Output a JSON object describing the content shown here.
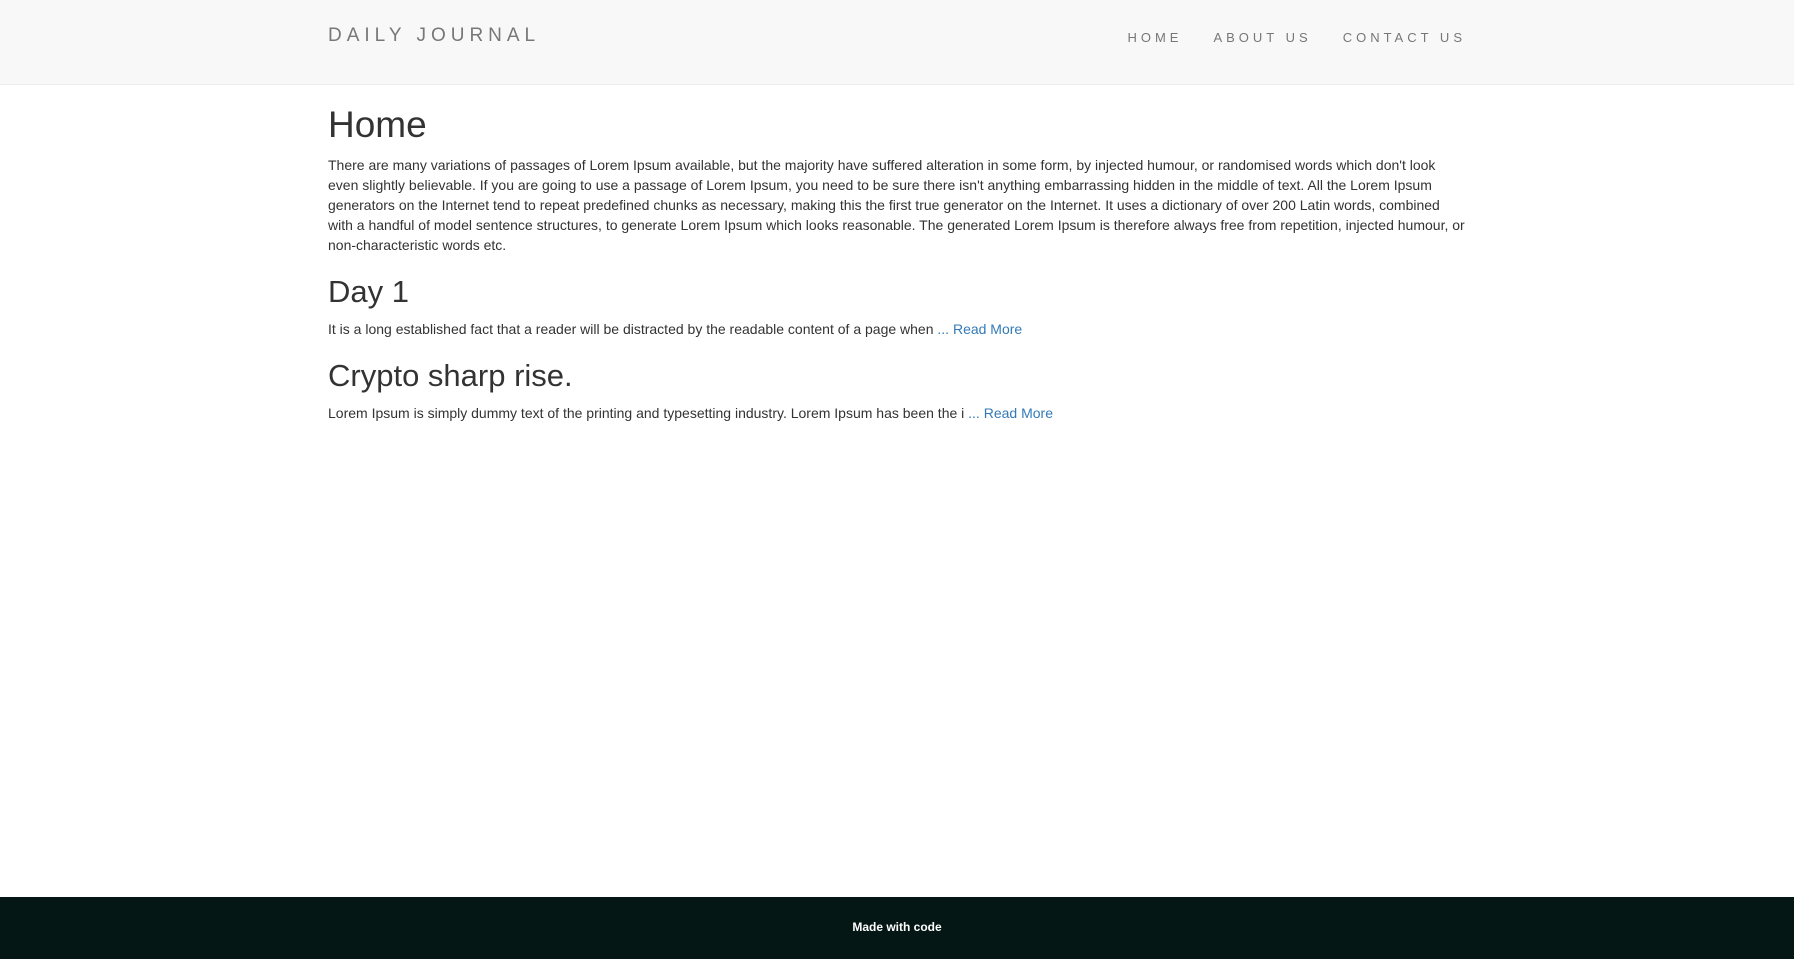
{
  "navbar": {
    "brand": "DAILY JOURNAL",
    "links": [
      {
        "label": "HOME"
      },
      {
        "label": "ABOUT US"
      },
      {
        "label": "CONTACT US"
      }
    ]
  },
  "main": {
    "title": "Home",
    "intro": "There are many variations of passages of Lorem Ipsum available, but the majority have suffered alteration in some form, by injected humour, or randomised words which don't look even slightly believable. If you are going to use a passage of Lorem Ipsum, you need to be sure there isn't anything embarrassing hidden in the middle of text. All the Lorem Ipsum generators on the Internet tend to repeat predefined chunks as necessary, making this the first true generator on the Internet. It uses a dictionary of over 200 Latin words, combined with a handful of model sentence structures, to generate Lorem Ipsum which looks reasonable. The generated Lorem Ipsum is therefore always free from repetition, injected humour, or non-characteristic words etc.",
    "posts": [
      {
        "title": "Day 1",
        "excerpt": "It is a long established fact that a reader will be distracted by the readable content of a page when ",
        "ellipsis": "...",
        "read_more": "Read More"
      },
      {
        "title": "Crypto sharp rise.",
        "excerpt": "Lorem Ipsum is simply dummy text of the printing and typesetting industry. Lorem Ipsum has been the i ",
        "ellipsis": "...",
        "read_more": "Read More"
      }
    ]
  },
  "footer": {
    "text": "Made with code"
  },
  "colors": {
    "navbar_bg": "#f8f8f8",
    "link": "#337ab7",
    "footer_bg": "#041714"
  }
}
